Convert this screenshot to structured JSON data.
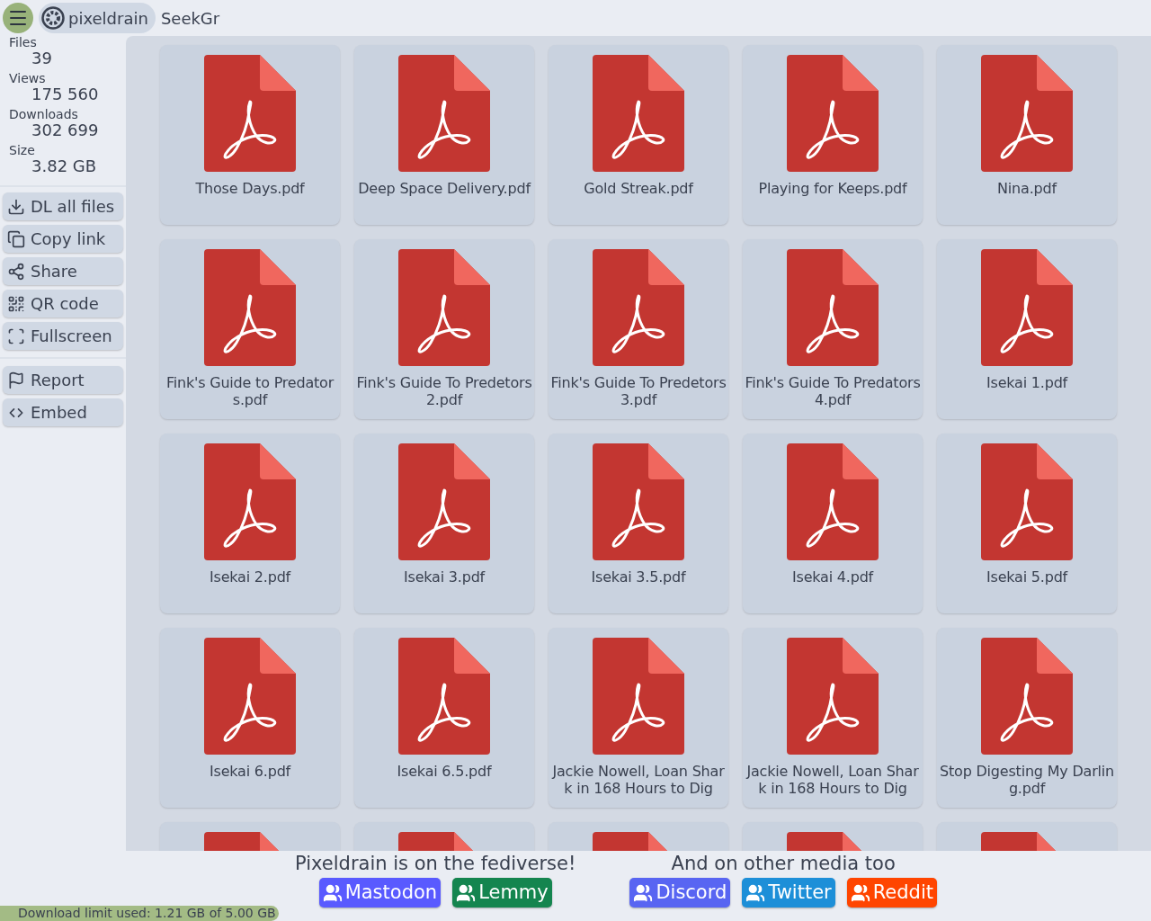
{
  "header": {
    "brand": "pixeldrain",
    "title": "SeekGr"
  },
  "stats": [
    {
      "label": "Files",
      "value": "39"
    },
    {
      "label": "Views",
      "value": "175 560"
    },
    {
      "label": "Downloads",
      "value": "302 699"
    },
    {
      "label": "Size",
      "value": "3.82 GB"
    }
  ],
  "actions": [
    {
      "kind": "download",
      "label": "DL all files"
    },
    {
      "kind": "copy",
      "label": "Copy link"
    },
    {
      "kind": "share",
      "label": "Share"
    },
    {
      "kind": "qr",
      "label": "QR code"
    },
    {
      "kind": "fullscreen",
      "label": "Fullscreen"
    },
    {
      "kind": "report",
      "label": "Report"
    },
    {
      "kind": "embed",
      "label": "Embed"
    }
  ],
  "files": [
    {
      "kind": "file",
      "name": "Those Days.pdf"
    },
    {
      "kind": "file",
      "name": "Deep Space Delivery.pdf"
    },
    {
      "kind": "file",
      "name": "Gold Streak.pdf"
    },
    {
      "kind": "file",
      "name": "Playing for Keeps.pdf"
    },
    {
      "kind": "file",
      "name": "Nina.pdf"
    },
    {
      "kind": "file",
      "name": "Fink's Guide to Predators.pdf"
    },
    {
      "kind": "file",
      "name": "Fink's Guide To Predetors 2.pdf"
    },
    {
      "kind": "file",
      "name": "Fink's Guide To Predetors 3.pdf"
    },
    {
      "kind": "file",
      "name": "Fink's Guide To Predators 4.pdf"
    },
    {
      "kind": "file",
      "name": "Isekai 1.pdf"
    },
    {
      "kind": "file",
      "name": "Isekai 2.pdf"
    },
    {
      "kind": "file",
      "name": "Isekai 3.pdf"
    },
    {
      "kind": "file",
      "name": "Isekai 3.5.pdf"
    },
    {
      "kind": "file",
      "name": "Isekai 4.pdf"
    },
    {
      "kind": "file",
      "name": "Isekai 5.pdf"
    },
    {
      "kind": "file",
      "name": "Isekai 6.pdf"
    },
    {
      "kind": "file",
      "name": "Isekai 6.5.pdf"
    },
    {
      "kind": "file",
      "name": "Jackie Nowell, Loan Shark in 168 Hours to Dig"
    },
    {
      "kind": "file",
      "name": "Jackie Nowell, Loan Shark in 168 Hours to Dig"
    },
    {
      "kind": "file",
      "name": "Stop Digesting My Darling.pdf"
    },
    {
      "kind": "cut"
    },
    {
      "kind": "cut"
    },
    {
      "kind": "cut"
    },
    {
      "kind": "cut"
    },
    {
      "kind": "cut"
    }
  ],
  "social_groups": [
    {
      "title": "Pixeldrain is on the fediverse!",
      "links": [
        {
          "label": "Mastodon",
          "color": "#595aff"
        },
        {
          "label": "Lemmy",
          "color": "#14854f"
        }
      ]
    },
    {
      "title": "And on other media too",
      "links": [
        {
          "label": "Discord",
          "color": "#5865f2"
        },
        {
          "label": "Twitter",
          "color": "#1d8fd8"
        },
        {
          "label": "Reddit",
          "color": "#ff4500"
        }
      ]
    }
  ],
  "download_limit": {
    "text": "Download limit used: 1.21 GB of 5.00 GB",
    "level": 0.242
  }
}
